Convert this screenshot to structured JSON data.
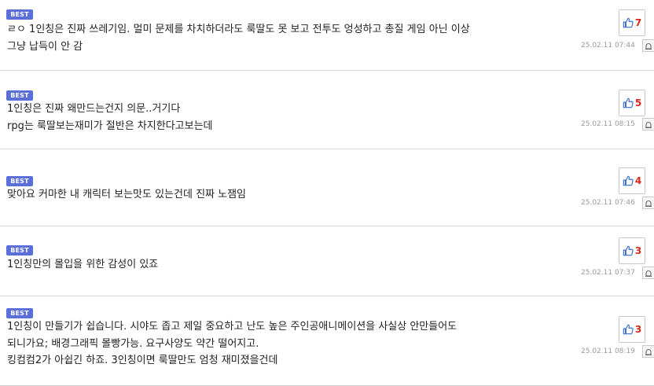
{
  "badge_label": "BEST",
  "comments": [
    {
      "lines": [
        "ㄹㅇ 1인칭은 진짜 쓰레기임. 멀미 문제를 차치하더라도 룩딸도 못 보고 전투도 엉성하고 총질 게임 아닌 이상",
        "그냥 납득이 안 감"
      ],
      "likes": "7",
      "date": "25.02.11 07:44"
    },
    {
      "lines": [
        "1인칭은 진짜 왜만드는건지 의문..거기다",
        "rpg는 룩딸보는재미가 절반은 차지한다고보는데"
      ],
      "likes": "5",
      "date": "25.02.11 08:15"
    },
    {
      "lines": [
        "맞아요 커마한 내 캐릭터 보는맛도 있는건데 진짜 노잼임"
      ],
      "likes": "4",
      "date": "25.02.11 07:46"
    },
    {
      "lines": [
        "1인칭만의 몰입을 위한 감성이 있죠"
      ],
      "likes": "3",
      "date": "25.02.11 07:37"
    },
    {
      "lines": [
        "1인칭이 만들기가 쉽습니다.  시야도 좁고 제일 중요하고 난도 높은 주인공애니메이션을 사실상 안만들어도",
        "되니가요; 배경그래픽 몰빵가능. 요구사양도 약간 떨어지고.",
        "킹컴컴2가 아쉽긴 하죠. 3인칭이면 룩딸만도 엄청 재미졌을건데"
      ],
      "likes": "3",
      "date": "25.02.11 08:19"
    }
  ],
  "colors": {
    "badge": "#5a6fd8",
    "like_count": "#d9271c",
    "thumb_icon": "#3a6fd0"
  },
  "icons": {
    "like": "thumbs-up-icon",
    "report": "siren-icon"
  }
}
